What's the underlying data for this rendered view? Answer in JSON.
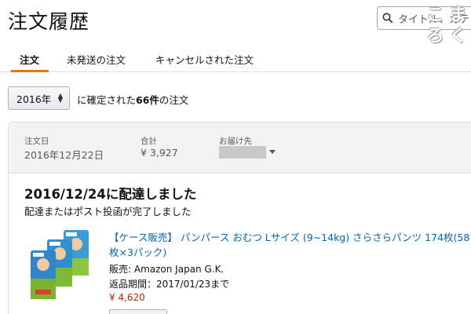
{
  "page": {
    "title": "注文履歴"
  },
  "search": {
    "placeholder": "タイトル、カテ"
  },
  "logo": {
    "chars": [
      "こ",
      "ま",
      "ろ",
      "く"
    ]
  },
  "tabs": [
    {
      "label": "注文",
      "active": true
    },
    {
      "label": "未発送の注文",
      "active": false
    },
    {
      "label": "キャンセルされた注文",
      "active": false
    }
  ],
  "filter": {
    "selected": "2016年",
    "text_prefix": "に確定された",
    "count": "66件",
    "text_suffix": "の注文"
  },
  "order": {
    "date_label": "注文日",
    "date": "2016年12月22日",
    "total_label": "合計",
    "total": "¥ 3,927",
    "ship_label": "お届け先",
    "status": "2016/12/24に配達しました",
    "status_sub": "配達またはポスト投函が完了しました",
    "item": {
      "title": "【ケース販売】 パンパース おむつ Lサイズ (9~14kg) さらさらパンツ 174枚(58枚×3パック)",
      "seller": "販売: Amazon Japan G.K.",
      "return_period": "返品期間：2017/01/23まで",
      "price": "¥ 4,620"
    }
  },
  "colors": {
    "link": "#0066c0",
    "price": "#b12704",
    "tab_accent": "#e47911",
    "header_bg": "#f3f3f3"
  }
}
